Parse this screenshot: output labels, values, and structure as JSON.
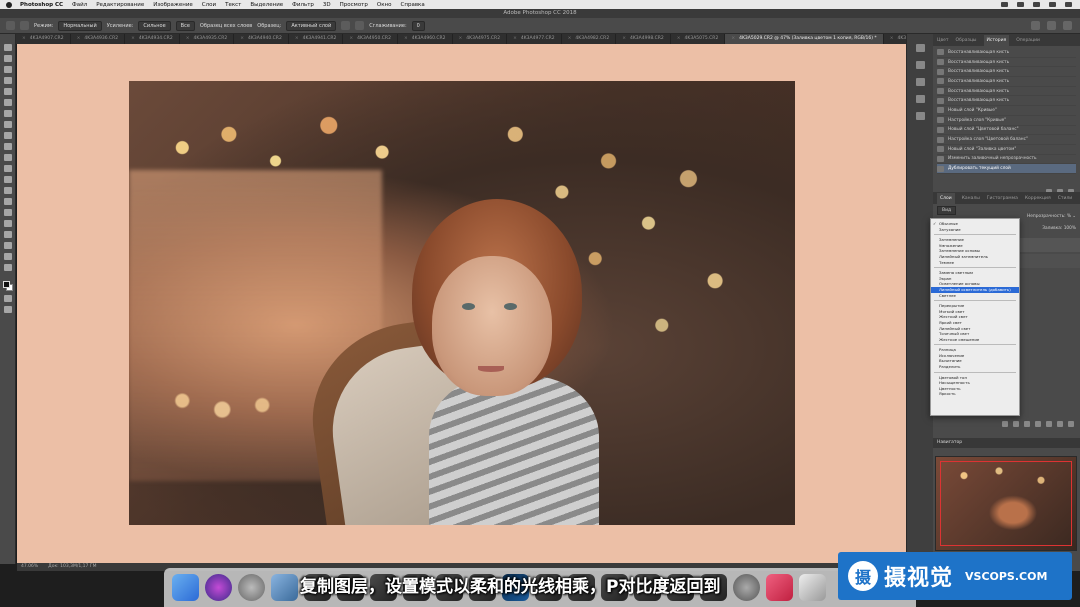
{
  "menubar": {
    "app": "Photoshop CC",
    "items": [
      "Файл",
      "Редактирование",
      "Изображение",
      "Слои",
      "Текст",
      "Выделение",
      "Фильтр",
      "3D",
      "Просмотр",
      "Окно",
      "Справка"
    ]
  },
  "app_title": "Adobe Photoshop CC 2018",
  "options": {
    "mode_label": "Режим:",
    "mode_value": "Нормальный",
    "pressure_label": "Усиление:",
    "pressure_value": "Сильное",
    "sample_value": "Все",
    "sample_checkbox": "Образец всех слоев",
    "sample_label": "Образец:",
    "sample_layer_value": "Активный слой",
    "smoothing_label": "Сглаживание:",
    "smoothing_value": "0"
  },
  "tabs": [
    {
      "label": "4K3A4907.CR2",
      "active": false
    },
    {
      "label": "4K3A4936.CR2",
      "active": false
    },
    {
      "label": "4K3A4934.CR2",
      "active": false
    },
    {
      "label": "4K3A4935.CR2",
      "active": false
    },
    {
      "label": "4K3A4940.CR2",
      "active": false
    },
    {
      "label": "4K3A4941.CR2",
      "active": false
    },
    {
      "label": "4K3A4950.CR2",
      "active": false
    },
    {
      "label": "4K3A4960.CR2",
      "active": false
    },
    {
      "label": "4K3A4975.CR2",
      "active": false
    },
    {
      "label": "4K3A4977.CR2",
      "active": false
    },
    {
      "label": "4K3A4982.CR2",
      "active": false
    },
    {
      "label": "4K3A4998.CR2",
      "active": false
    },
    {
      "label": "4K3A5075.CR2",
      "active": false
    },
    {
      "label": "4K3A5029.CR2 @ 47% (Заливка цветом 1 копия, RGB/16) *",
      "active": true
    },
    {
      "label": "4K3A5033.CR2",
      "active": false
    },
    {
      "label": "4K",
      "active": false
    }
  ],
  "status": {
    "zoom": "47.06%",
    "doc": "Док: 103,3M/1,17 ГМ"
  },
  "history_panel": {
    "tabs": [
      "Цвет",
      "Образцы",
      "История",
      "Операции"
    ],
    "active_tab": "История",
    "rows": [
      "Восстанавливающая кисть",
      "Восстанавливающая кисть",
      "Восстанавливающая кисть",
      "Восстанавливающая кисть",
      "Восстанавливающая кисть",
      "Восстанавливающая кисть",
      "Новый слой \"Кривые\"",
      "Настройка слоя \"Кривые\"",
      "Новый слой \"Цветовой баланс\"",
      "Настройка слоя \"Цветовой баланс\"",
      "Новый слой \"Заливка цветом\"",
      "Изменить заливочный непрозрачность",
      "Дублировать текущий слой"
    ],
    "selected_index": 12
  },
  "layers_panel": {
    "tabs": [
      "Слои",
      "Каналы",
      "Гистограмма",
      "Коррекция",
      "Стили"
    ],
    "kind_label": "Вид",
    "opacity_label": "Непрозрачность:",
    "opacity_value": "% ⌄",
    "fill_label": "Заливка:",
    "fill_value": "100%"
  },
  "blend_menu": {
    "groups": [
      [
        "Обычные",
        "Затухание"
      ],
      [
        "Затемнение",
        "Умножение",
        "Затемнение основы",
        "Линейный затемнитель",
        "Темнее"
      ],
      [
        "Замена светлым",
        "Экран",
        "Осветление основы",
        "Линейный осветлитель (добавить)",
        "Светлее"
      ],
      [
        "Перекрытие",
        "Мягкий свет",
        "Жесткий свет",
        "Яркий свет",
        "Линейный свет",
        "Точечный свет",
        "Жесткое смешение"
      ],
      [
        "Разница",
        "Исключение",
        "Вычитание",
        "Разделить"
      ],
      [
        "Цветовой тон",
        "Насыщенность",
        "Цветность",
        "Яркость"
      ]
    ],
    "checked": "Обычные",
    "highlighted": "Линейный осветлитель (добавить)"
  },
  "navigator": {
    "title": "Навигатор"
  },
  "subtitle": "复制图层，设置模式以柔和的光线相乘，P对比度返回到",
  "watermark": {
    "cn": "摄视觉",
    "en": "VSCOPS.COM",
    "logo": "摄"
  },
  "colors": {
    "canvas_bg": "#ecbfa6",
    "selection_highlight": "#2b6ad6",
    "watermark": "#1e73c8"
  }
}
